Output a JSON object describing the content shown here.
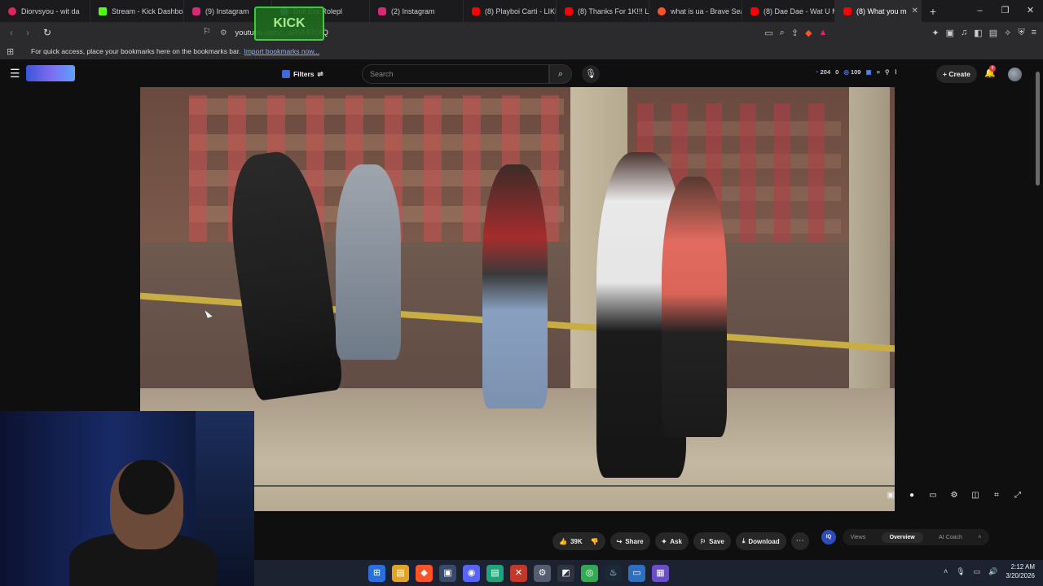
{
  "browser": {
    "tabs": [
      {
        "title": "Diorvsyou - wit da",
        "color": "#e0245e"
      },
      {
        "title": "Stream - Kick Dashboa",
        "color": "#53fc18"
      },
      {
        "title": "(9) Instagram",
        "color": "#d62976"
      },
      {
        "title": "Drill Era Rolepl",
        "color": "#4aa8ff"
      },
      {
        "title": "(2) Instagram",
        "color": "#d62976"
      },
      {
        "title": "(8) Playboi Carti - LIKE",
        "color": "#ff0000"
      },
      {
        "title": "(8) Thanks For 1K!!! Le",
        "color": "#ff0000"
      },
      {
        "title": "what is ua - Brave Sea",
        "color": "#fb542b"
      },
      {
        "title": "(8) Dae Dae - Wat U M",
        "color": "#ff0000"
      },
      {
        "title": "(8) What you m",
        "color": "#ff0000"
      }
    ],
    "new_tab": "+",
    "window_controls": [
      "–",
      "❐",
      "✕"
    ],
    "url_prefix": "",
    "url": "youtube.com/...aRVHi7rXQ",
    "bookmark_hint": "For quick access, place your bookmarks here on the bookmarks bar.",
    "bookmark_link": "Import bookmarks now..."
  },
  "overlay_logo": "KICK",
  "youtube": {
    "filters_label": "Filters",
    "search_placeholder": "Search",
    "stats": {
      "a": "204",
      "b": "0",
      "c": "109"
    },
    "create_label": "Create",
    "notif_count": "9",
    "actions": {
      "likes": "39K",
      "share": "Share",
      "ask": "Ask",
      "save": "Save",
      "download": "Download"
    },
    "panel_tabs": [
      "Views",
      "Overview",
      "AI Coach"
    ],
    "active_panel_tab": "Overview",
    "iq_label": "IQ"
  },
  "taskbar": {
    "time": "2:12 AM",
    "date": "3/20/2026"
  }
}
